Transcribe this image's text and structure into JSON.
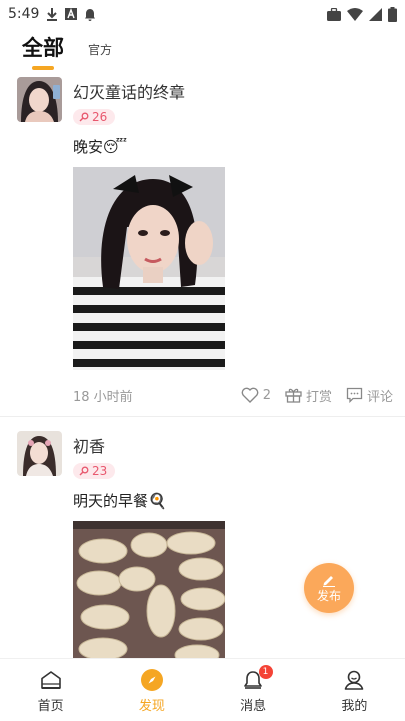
{
  "status_bar": {
    "time": "5:49",
    "left_icons": [
      "download-icon",
      "a-box-icon",
      "notification-icon"
    ],
    "right_icons": [
      "briefcase-icon",
      "wifi-icon",
      "signal-icon",
      "battery-icon"
    ]
  },
  "tabs": [
    {
      "label": "全部",
      "active": true
    },
    {
      "label": "官方",
      "active": false
    }
  ],
  "posts": [
    {
      "username": "幻灭童话的终章",
      "level": "26",
      "text": "晚安😴",
      "time": "18 小时前",
      "likes": "2",
      "reward_label": "打赏",
      "comment_label": "评论"
    },
    {
      "username": "初香",
      "level": "23",
      "text": "明天的早餐🍳"
    }
  ],
  "fab": {
    "label": "发布"
  },
  "bottom_nav": [
    {
      "label": "首页",
      "icon": "home-icon",
      "active": false
    },
    {
      "label": "发现",
      "icon": "compass-icon",
      "active": true
    },
    {
      "label": "消息",
      "icon": "bell-icon",
      "active": false,
      "badge": "1"
    },
    {
      "label": "我的",
      "icon": "person-icon",
      "active": false
    }
  ],
  "colors": {
    "accent": "#f5a623",
    "fab": "#fba85a",
    "level_badge_text": "#e8586e",
    "level_badge_bg": "#fde9ec",
    "notification_badge": "#f44336"
  }
}
